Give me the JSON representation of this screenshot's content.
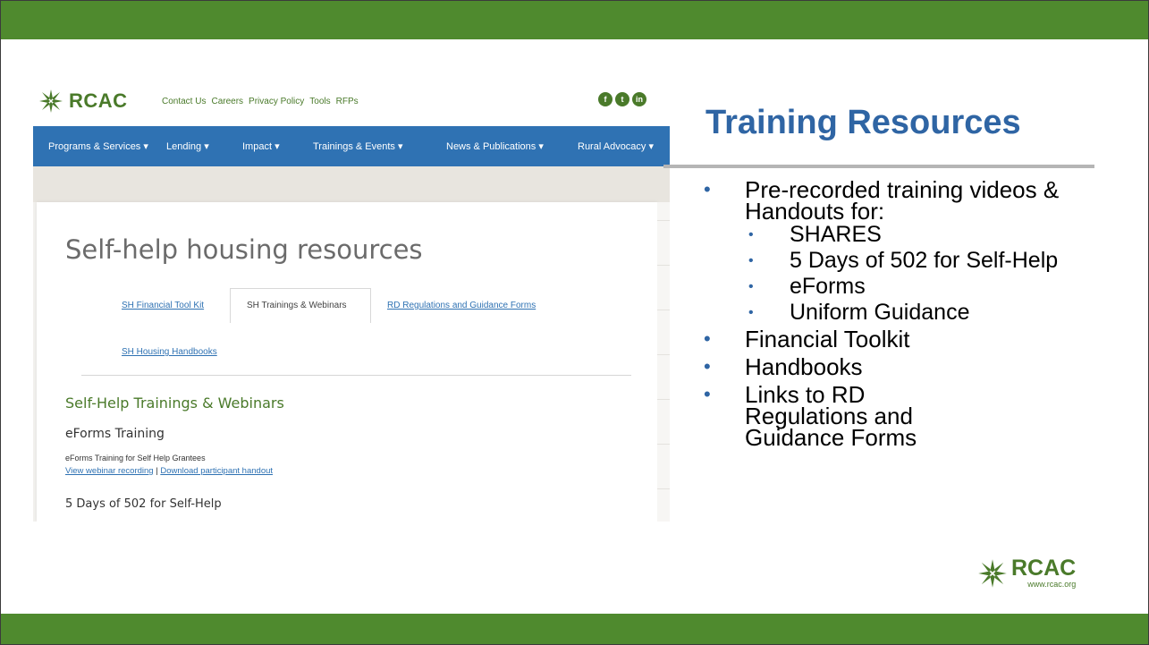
{
  "colors": {
    "band_green": "#4f8a2e",
    "title_blue": "#2f65a4",
    "nav_blue": "#2f72b3",
    "rcac_green": "#4a7a2a"
  },
  "slide": {
    "title": "Training Resources",
    "bullets": {
      "b0": "Pre-recorded training videos & Handouts for:",
      "s0": "SHARES",
      "s1": "5 Days of 502 for Self-Help",
      "s2": "eForms",
      "s3": "Uniform Guidance",
      "b1": "Financial Toolkit",
      "b2": "Handbooks",
      "b3": "Links to RD Regulations and Guidance Forms"
    },
    "bullet_glyph": "•",
    "logo": {
      "text": "RCAC",
      "url": "www.rcac.org"
    }
  },
  "website": {
    "logo_text": "RCAC",
    "top_links": [
      "Contact Us",
      "Careers",
      "Privacy Policy",
      "Tools",
      "RFPs"
    ],
    "social": [
      "f",
      "t",
      "in"
    ],
    "nav": [
      "Programs & Services ▾",
      "Lending ▾",
      "Impact ▾",
      "Trainings & Events ▾",
      "News & Publications ▾",
      "Rural Advocacy ▾"
    ],
    "page_title": "Self-help housing resources",
    "tabs": {
      "financial": "SH Financial Tool Kit",
      "trainings": "SH Trainings & Webinars",
      "rd": "RD Regulations and Guidance Forms",
      "handbooks": "SH Housing Handbooks"
    },
    "section_title": "Self-Help Trainings & Webinars",
    "eforms_title": "eForms Training",
    "eforms_desc": "eForms Training for Self Help Grantees",
    "link_recording": "View webinar recording",
    "link_sep": " | ",
    "link_handout": "Download participant handout",
    "next_title": "5 Days of 502 for Self-Help"
  }
}
